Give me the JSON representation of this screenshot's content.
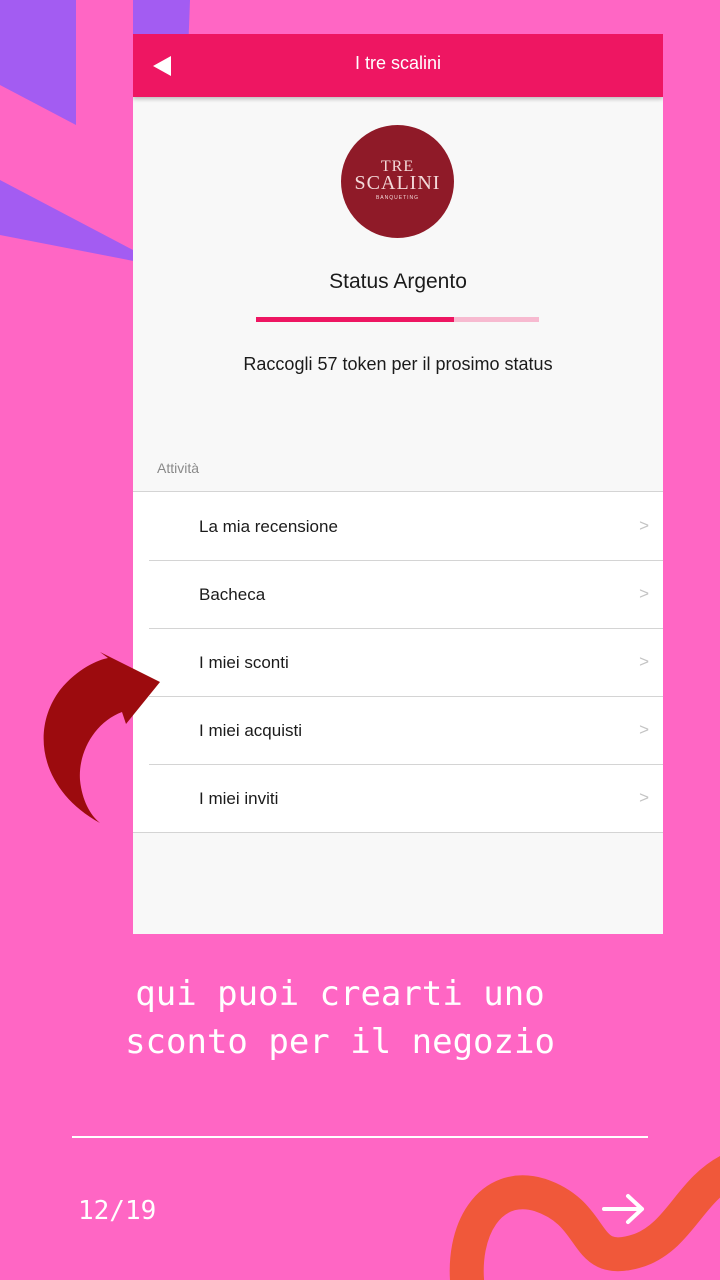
{
  "app": {
    "title": "I tre scalini"
  },
  "logo": {
    "line1": "TRE",
    "line2": "SCALINI",
    "line3": "BANQUETING"
  },
  "status": {
    "title": "Status Argento",
    "progress_fraction": 0.7,
    "token_message": "Raccogli 57 token per il prosimo status"
  },
  "activity": {
    "section_label": "Attività",
    "items": [
      {
        "label": "La mia recensione",
        "chevron": ">"
      },
      {
        "label": "Bacheca",
        "chevron": ">"
      },
      {
        "label": "I miei sconti",
        "chevron": ">"
      },
      {
        "label": "I miei acquisti",
        "chevron": ">"
      },
      {
        "label": "I miei inviti",
        "chevron": ">"
      }
    ]
  },
  "caption": {
    "line1": "qui puoi crearti uno",
    "line2": "sconto per il negozio"
  },
  "footer": {
    "page": "12/19"
  },
  "icons": {
    "back": "back-triangle-icon",
    "next": "arrow-right-icon",
    "pointer": "curved-arrow-icon"
  },
  "colors": {
    "background": "#ff66c4",
    "appbar": "#ee1662",
    "progress_track": "#f7bad0",
    "logo": "#8f1a28",
    "accent_purple": "#a35cf2",
    "accent_orange": "#f0583a",
    "arrow_red": "#9c0b0e"
  }
}
